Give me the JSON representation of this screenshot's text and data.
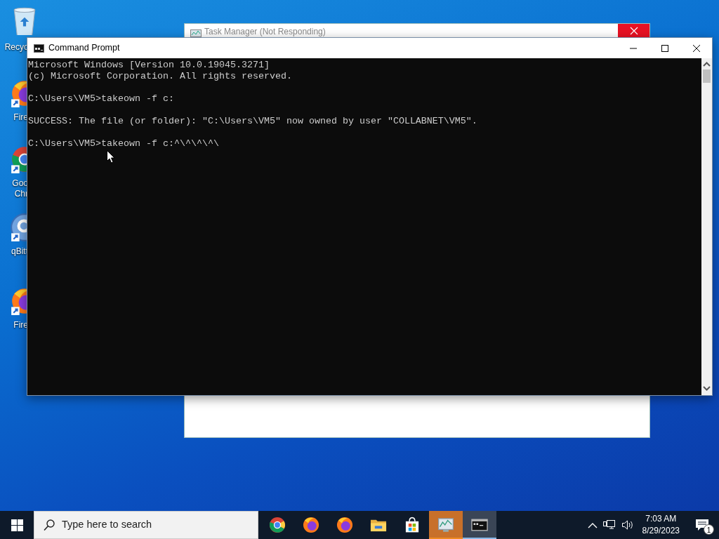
{
  "desktop_icons": [
    {
      "kind": "recycle_bin",
      "label_lines": [
        "Recyc"
      ]
    },
    {
      "kind": "firefox",
      "label_lines": [
        "Fire"
      ]
    },
    {
      "kind": "chrome",
      "label_lines": [
        "Goo",
        "Chr"
      ]
    },
    {
      "kind": "qbittorrent",
      "label_lines": [
        "qBitt"
      ]
    },
    {
      "kind": "firefox",
      "label_lines": [
        "Fire"
      ]
    }
  ],
  "background_window": {
    "title": "Task Manager (Not Responding)"
  },
  "command_prompt": {
    "title": "Command Prompt",
    "output_blocks": [
      {
        "lines": [
          "Microsoft Windows [Version 10.0.19045.3271]",
          "(c) Microsoft Corporation. All rights reserved."
        ]
      },
      {
        "lines": [
          "C:\\Users\\VM5>takeown -f c:"
        ]
      },
      {
        "lines": [
          "SUCCESS: The file (or folder): \"C:\\Users\\VM5\" now owned by user \"COLLABNET\\VM5\"."
        ]
      },
      {
        "lines": [
          "C:\\Users\\VM5>takeown -f c:^\\^\\^\\^\\"
        ]
      }
    ]
  },
  "taskbar": {
    "search": {
      "placeholder": "Type here to search"
    },
    "apps": [
      {
        "kind": "chrome",
        "selected": false,
        "flashing": false
      },
      {
        "kind": "firefox",
        "selected": false,
        "flashing": false
      },
      {
        "kind": "firefox",
        "selected": false,
        "flashing": false
      },
      {
        "kind": "file_explorer",
        "selected": false,
        "flashing": false
      },
      {
        "kind": "store",
        "selected": false,
        "flashing": false
      },
      {
        "kind": "task_manager",
        "selected": false,
        "flashing": true
      },
      {
        "kind": "command_prompt",
        "selected": true,
        "flashing": false
      }
    ],
    "clock": {
      "time": "7:03 AM",
      "date": "8/29/2023"
    },
    "notifications": {
      "count": "1"
    }
  }
}
